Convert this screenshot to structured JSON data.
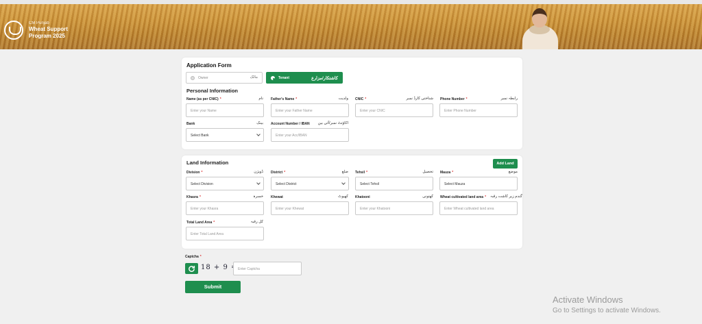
{
  "banner": {
    "program_small": "CM Punjab",
    "program_name_line1": "Wheat Support",
    "program_name_line2": "Program 2025"
  },
  "application": {
    "title": "Application Form",
    "types": [
      {
        "label": "Owner",
        "urdu": "مالک",
        "selected": false
      },
      {
        "label": "Tenant",
        "urdu": "کاشتکار/مزارع",
        "selected": true
      }
    ]
  },
  "personal": {
    "title": "Personal Information",
    "fields": [
      {
        "label": "Name (as per CNIC)",
        "required": true,
        "urdu": "نام",
        "placeholder": "Enter your  Name"
      },
      {
        "label": "Father's Name",
        "required": true,
        "urdu": "ولدیت",
        "placeholder": "Enter your Father Name"
      },
      {
        "label": "CNIC",
        "required": true,
        "urdu": "شناختی کارڈ نمبر",
        "placeholder": "Enter your CNIC"
      },
      {
        "label": "Phone Number",
        "required": true,
        "urdu": "رابطہ نمبر",
        "placeholder": "Enter Phone Number"
      },
      {
        "label": "Bank",
        "required": false,
        "urdu": "بینک",
        "value": "Select Bank"
      },
      {
        "label": "Account Number / IBAN",
        "required": false,
        "urdu": "اکاؤنٹ نمبر/آئی بین",
        "placeholder": "Enter your Acc/IBAN"
      }
    ]
  },
  "land": {
    "title": "Land Information",
    "add_button": "Add Land",
    "fields": [
      {
        "label": "Division",
        "required": true,
        "urdu": "ڈویژن",
        "value": "Select Division"
      },
      {
        "label": "District",
        "required": true,
        "urdu": "ضلع",
        "value": "Select District"
      },
      {
        "label": "Tehsil",
        "required": true,
        "urdu": "تحصیل",
        "value": "Select Tehsil"
      },
      {
        "label": "Mauza",
        "required": true,
        "urdu": "موضع",
        "value": "Select Mauza"
      },
      {
        "label": "Khasra",
        "required": true,
        "urdu": "خسرہ",
        "placeholder": "Enter your Khasra"
      },
      {
        "label": "Khewat",
        "required": false,
        "urdu": "کھیوٹ",
        "placeholder": "Enter your Khewat"
      },
      {
        "label": "Khatooni",
        "required": false,
        "urdu": "کھتونی",
        "placeholder": "Enter your Khatooni"
      },
      {
        "label": "Wheat cultivated land area",
        "required": true,
        "urdu": "گندم زیر کاشت رقبہ",
        "placeholder": "Enter Wheat cultivated land area"
      },
      {
        "label": "Total Land Area",
        "required": true,
        "urdu": "کل رقبہ",
        "placeholder": "Enter Total Land Area"
      }
    ]
  },
  "captcha": {
    "label": "Captcha",
    "required": true,
    "challenge": "18 + 9 =",
    "placeholder": "Enter Captcha"
  },
  "submit_label": "Submit",
  "windows": {
    "line1": "Activate Windows",
    "line2": "Go to Settings to activate Windows."
  },
  "colors": {
    "accent": "#1e8e4e",
    "required": "#dd3333"
  },
  "icons": {
    "refresh": "refresh-icon",
    "logo": "punjab-logo-icon"
  }
}
